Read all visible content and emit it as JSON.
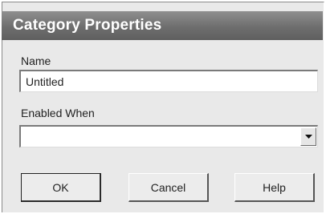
{
  "dialog": {
    "title": "Category Properties"
  },
  "name_field": {
    "label": "Name",
    "value": "Untitled"
  },
  "enabled_when_field": {
    "label": "Enabled When",
    "value": "",
    "arrow_icon": "dropdown-arrow-icon"
  },
  "buttons": {
    "ok": "OK",
    "cancel": "Cancel",
    "help": "Help"
  }
}
